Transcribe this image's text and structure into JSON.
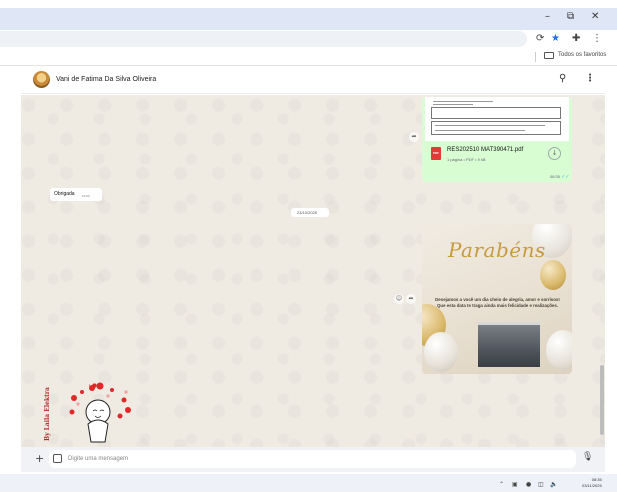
{
  "browser": {
    "window_controls": {
      "minimize": "–",
      "restore": "⧉",
      "close": "✕"
    },
    "toolbar_icons": [
      "translate-icon",
      "star-icon",
      "extensions-icon",
      "menu-icon"
    ],
    "bookmarks": {
      "folder_label": "Todos os favoritos"
    }
  },
  "chat": {
    "contact_name": "Vani de Fatima Da Silva Oliveira",
    "messages": {
      "document": {
        "file_name": "RES202510 MAT390471.pdf",
        "meta": "1 página • PDF • 9 kB",
        "badge": "PDF",
        "time": "08:35"
      },
      "incoming": {
        "text": "Obrigada",
        "time": "10:04"
      },
      "date_separator": "23/10/2025",
      "image": {
        "title": "Parabéns",
        "body": "Desejamos a você um dia cheio de alegria, amor e sorrisos! Que esta data te traga ainda mais felicidade e realizações."
      },
      "sticker": {
        "signature": "By Laila Elektra"
      }
    },
    "composer": {
      "placeholder": "Digite uma mensagem"
    }
  },
  "taskbar": {
    "time": "08:35",
    "date": "03/11/2025"
  },
  "colors": {
    "outgoing_bubble": "#d9fdd3",
    "chat_background": "#efeae2",
    "pdf_red": "#e53935",
    "read_ticks": "#53bdeb"
  }
}
